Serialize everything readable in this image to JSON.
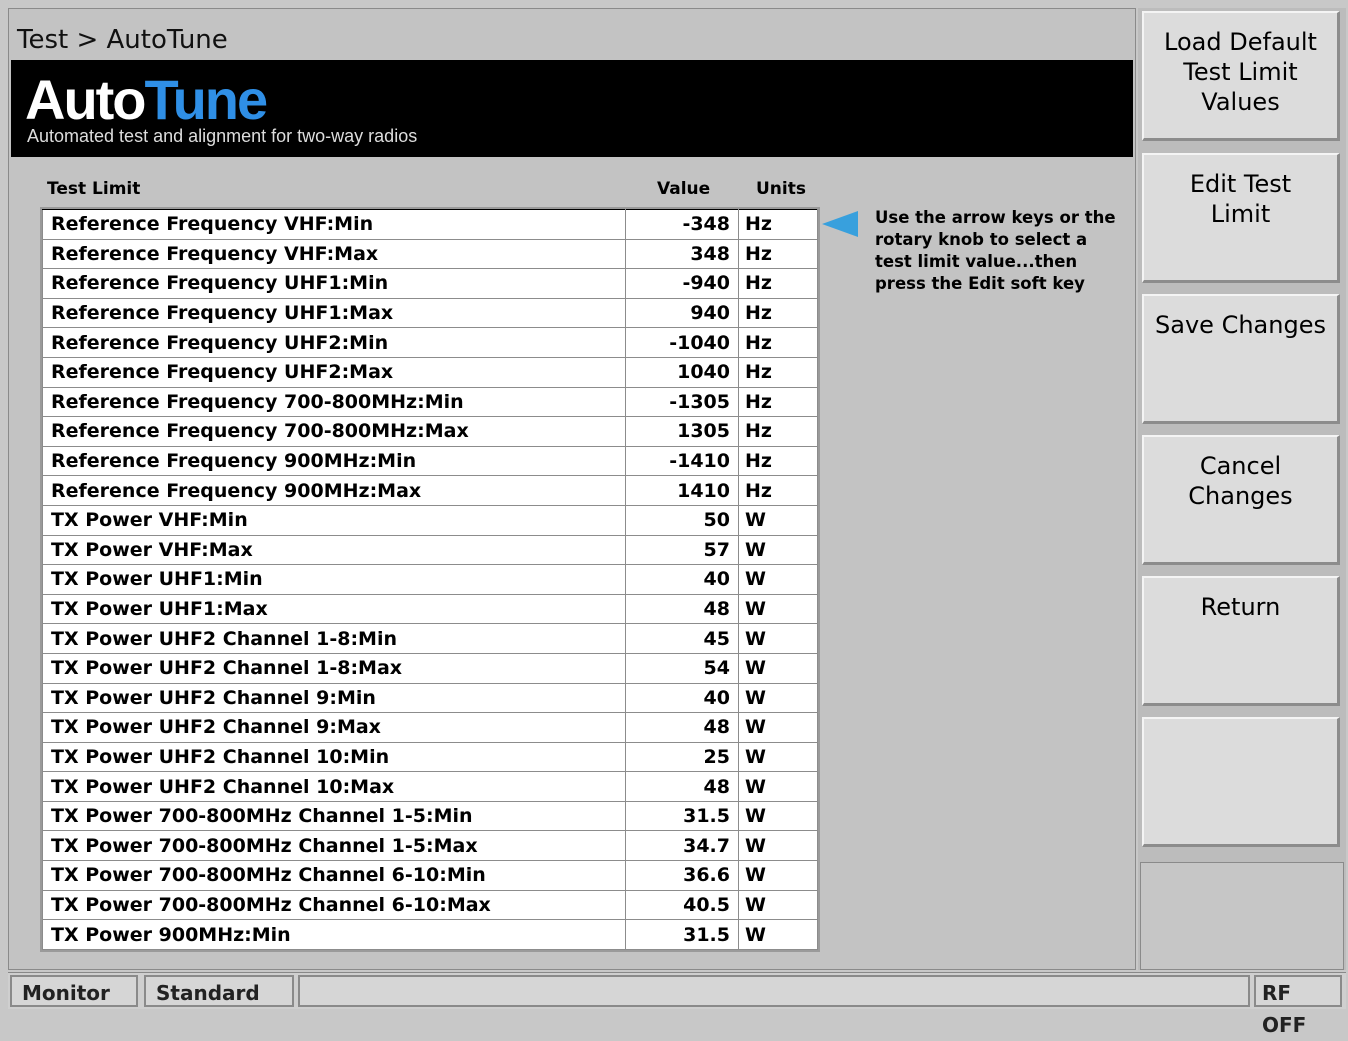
{
  "breadcrumb": "Test > AutoTune",
  "banner": {
    "logo_part1": "Auto",
    "logo_part2": "Tune",
    "tagline": "Automated test and alignment for two-way radios"
  },
  "table": {
    "headers": {
      "name": "Test Limit",
      "value": "Value",
      "units": "Units"
    },
    "rows": [
      {
        "name": "Reference Frequency VHF:Min",
        "value": "-348",
        "units": "Hz"
      },
      {
        "name": "Reference Frequency VHF:Max",
        "value": "348",
        "units": "Hz"
      },
      {
        "name": "Reference Frequency UHF1:Min",
        "value": "-940",
        "units": "Hz"
      },
      {
        "name": "Reference Frequency UHF1:Max",
        "value": "940",
        "units": "Hz"
      },
      {
        "name": "Reference Frequency UHF2:Min",
        "value": "-1040",
        "units": "Hz"
      },
      {
        "name": "Reference Frequency UHF2:Max",
        "value": "1040",
        "units": "Hz"
      },
      {
        "name": "Reference Frequency 700-800MHz:Min",
        "value": "-1305",
        "units": "Hz"
      },
      {
        "name": "Reference Frequency 700-800MHz:Max",
        "value": "1305",
        "units": "Hz"
      },
      {
        "name": "Reference Frequency 900MHz:Min",
        "value": "-1410",
        "units": "Hz"
      },
      {
        "name": "Reference Frequency 900MHz:Max",
        "value": "1410",
        "units": "Hz"
      },
      {
        "name": "TX Power VHF:Min",
        "value": "50",
        "units": "W"
      },
      {
        "name": "TX Power VHF:Max",
        "value": "57",
        "units": "W"
      },
      {
        "name": "TX Power UHF1:Min",
        "value": "40",
        "units": "W"
      },
      {
        "name": "TX Power UHF1:Max",
        "value": "48",
        "units": "W"
      },
      {
        "name": "TX Power UHF2 Channel 1-8:Min",
        "value": "45",
        "units": "W"
      },
      {
        "name": "TX Power UHF2 Channel 1-8:Max",
        "value": "54",
        "units": "W"
      },
      {
        "name": "TX Power UHF2 Channel 9:Min",
        "value": "40",
        "units": "W"
      },
      {
        "name": "TX Power UHF2 Channel 9:Max",
        "value": "48",
        "units": "W"
      },
      {
        "name": "TX Power UHF2 Channel 10:Min",
        "value": "25",
        "units": "W"
      },
      {
        "name": "TX Power UHF2 Channel 10:Max",
        "value": "48",
        "units": "W"
      },
      {
        "name": "TX Power 700-800MHz Channel 1-5:Min",
        "value": "31.5",
        "units": "W"
      },
      {
        "name": "TX Power 700-800MHz Channel 1-5:Max",
        "value": "34.7",
        "units": "W"
      },
      {
        "name": "TX Power 700-800MHz Channel 6-10:Min",
        "value": "36.6",
        "units": "W"
      },
      {
        "name": "TX Power 700-800MHz Channel 6-10:Max",
        "value": "40.5",
        "units": "W"
      },
      {
        "name": "TX Power 900MHz:Min",
        "value": "31.5",
        "units": "W"
      }
    ]
  },
  "hint": "Use the arrow keys or the rotary knob to select a test limit value...then press the Edit soft key",
  "softkeys": [
    {
      "label": "Load Default\nTest Limit\nValues"
    },
    {
      "label": "Edit Test\nLimit"
    },
    {
      "label": "Save Changes"
    },
    {
      "label": "Cancel\nChanges"
    },
    {
      "label": "Return"
    },
    {
      "label": ""
    }
  ],
  "status_bar": {
    "monitor": "Monitor",
    "standard": "Standard",
    "rf": "RF OFF"
  },
  "colors": {
    "logo_accent": "#2f8fe6",
    "pointer": "#38a0dd",
    "banner_bg": "#000000"
  }
}
